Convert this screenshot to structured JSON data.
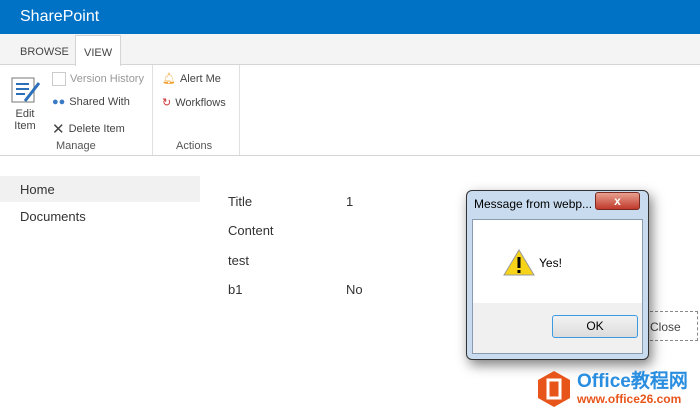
{
  "header": {
    "title": "SharePoint"
  },
  "tabs": [
    {
      "label": "BROWSE"
    },
    {
      "label": "VIEW"
    }
  ],
  "ribbon": {
    "edit_item": "Edit Item",
    "version_history": "Version History",
    "shared_with": "Shared With",
    "delete_item": "Delete Item",
    "manage_group": "Manage",
    "alert_me": "Alert Me",
    "workflows": "Workflows",
    "actions_group": "Actions"
  },
  "nav": [
    {
      "label": "Home"
    },
    {
      "label": "Documents"
    }
  ],
  "fields": [
    {
      "label": "Title",
      "value": "1"
    },
    {
      "label": "Content",
      "value": ""
    },
    {
      "label": "test",
      "value": ""
    },
    {
      "label": "b1",
      "value": "No"
    }
  ],
  "close_label": "Close",
  "dialog": {
    "title": "Message from webp...",
    "message": "Yes!",
    "ok": "OK",
    "close_glyph": "x"
  },
  "watermark": {
    "brand": "Office教程网",
    "url": "www.office26.com"
  }
}
